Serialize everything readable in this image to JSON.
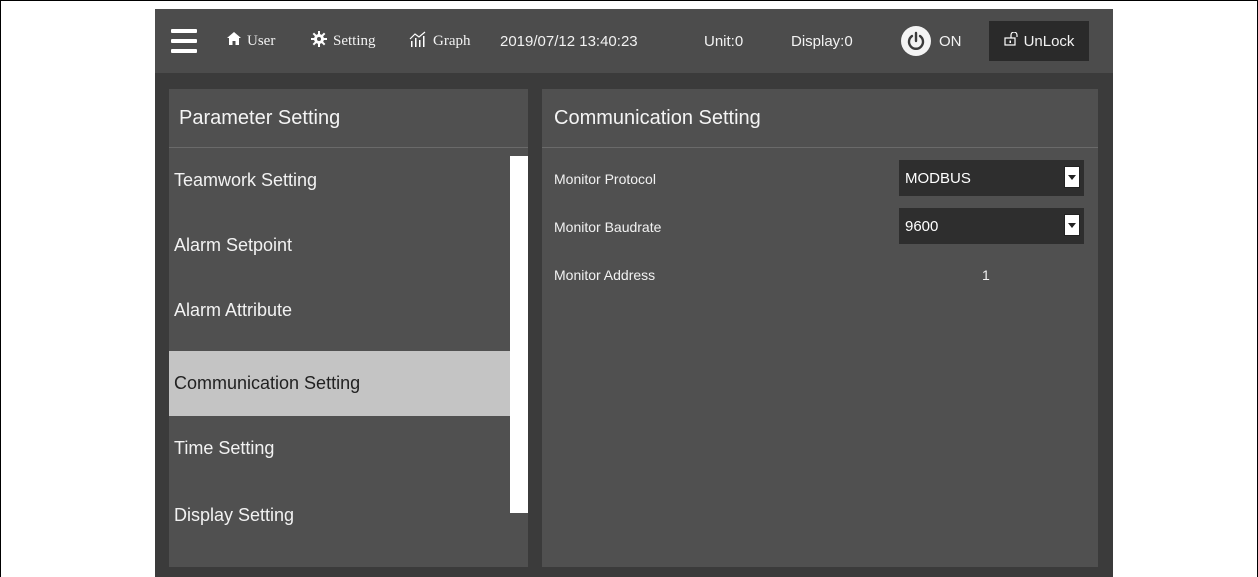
{
  "topbar": {
    "user": "User",
    "setting": "Setting",
    "graph": "Graph",
    "datetime": "2019/07/12 13:40:23",
    "unit": "Unit:0",
    "display": "Display:0",
    "power_label": "ON",
    "unlock_label": "UnLock"
  },
  "left_panel": {
    "title": "Parameter Setting",
    "items": [
      {
        "label": "Teamwork Setting"
      },
      {
        "label": "Alarm Setpoint"
      },
      {
        "label": "Alarm Attribute"
      },
      {
        "label": "Communication Setting"
      },
      {
        "label": "Time Setting"
      },
      {
        "label": "Display Setting"
      }
    ],
    "active_index": 3
  },
  "right_panel": {
    "title": "Communication Setting",
    "fields": [
      {
        "label": "Monitor Protocol",
        "value": "MODBUS"
      },
      {
        "label": "Monitor Baudrate",
        "value": "9600"
      },
      {
        "label": "Monitor Address",
        "value": "1"
      }
    ]
  },
  "colors": {
    "device_bg": "#3b3b3b",
    "topbar_bg": "#4c4c4c",
    "panel_bg": "#505050",
    "active_item_bg": "#c4c4c4",
    "select_bg": "#2e2e2e"
  }
}
